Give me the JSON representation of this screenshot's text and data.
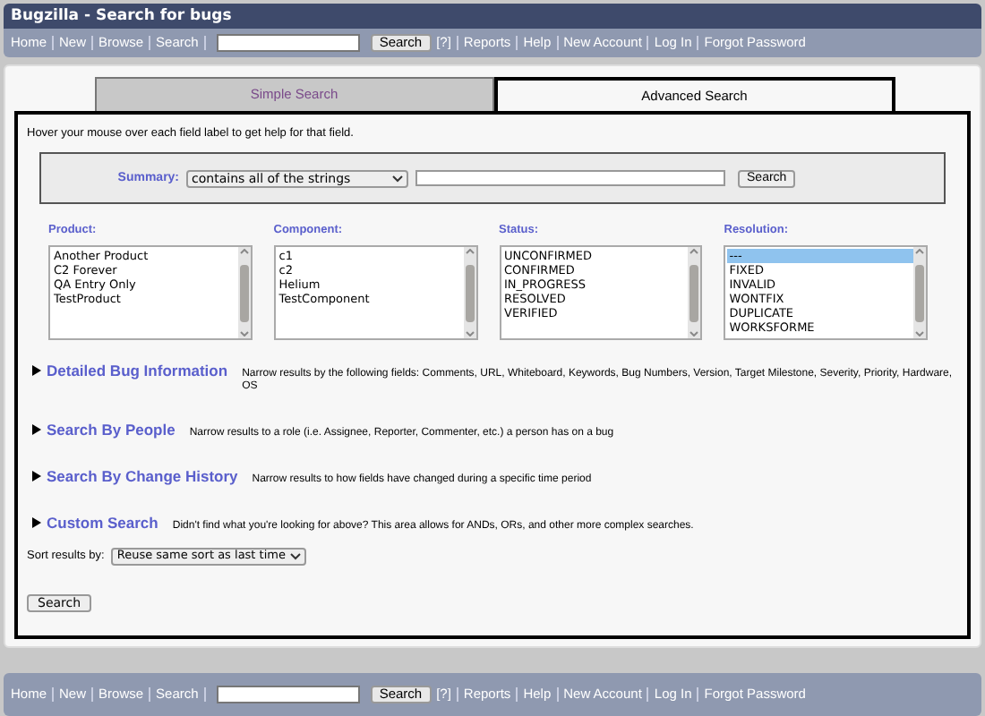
{
  "window": {
    "title": "Bugzilla - Search for bugs"
  },
  "top_nav": {
    "links_before": [
      "Home",
      "New",
      "Browse",
      "Search"
    ],
    "button": "Search",
    "help": "[?]",
    "links_after": [
      "Reports",
      "Help",
      "New Account",
      "Log In",
      "Forgot Password"
    ]
  },
  "tabs": [
    {
      "label": "Simple Search",
      "selected": false
    },
    {
      "label": "Advanced Search",
      "selected": true
    }
  ],
  "hint": "Hover your mouse over each field label to get help for that field.",
  "summary": {
    "label": "Summary:",
    "operator": "contains all of the strings",
    "button": "Search"
  },
  "lists": [
    {
      "label": "Product:",
      "items": [
        {
          "text": "Another Product",
          "selected": false
        },
        {
          "text": "C2 Forever",
          "selected": false
        },
        {
          "text": "QA Entry Only",
          "selected": false
        },
        {
          "text": "TestProduct",
          "selected": false
        }
      ]
    },
    {
      "label": "Component:",
      "items": [
        {
          "text": "c1",
          "selected": false
        },
        {
          "text": "c2",
          "selected": false
        },
        {
          "text": "Helium",
          "selected": false
        },
        {
          "text": "TestComponent",
          "selected": false
        }
      ]
    },
    {
      "label": "Status:",
      "items": [
        {
          "text": "UNCONFIRMED",
          "selected": false
        },
        {
          "text": "CONFIRMED",
          "selected": false
        },
        {
          "text": "IN_PROGRESS",
          "selected": false
        },
        {
          "text": "RESOLVED",
          "selected": false
        },
        {
          "text": "VERIFIED",
          "selected": false
        }
      ]
    },
    {
      "label": "Resolution:",
      "items": [
        {
          "text": "---",
          "selected": true
        },
        {
          "text": "FIXED",
          "selected": false
        },
        {
          "text": "INVALID",
          "selected": false
        },
        {
          "text": "WONTFIX",
          "selected": false
        },
        {
          "text": "DUPLICATE",
          "selected": false
        },
        {
          "text": "WORKSFORME",
          "selected": false
        }
      ]
    }
  ],
  "sections": [
    {
      "title": "Detailed Bug Information",
      "description": "Narrow results by the following fields: Comments, URL, Whiteboard, Keywords, Bug Numbers, Version, Target Milestone, Severity, Priority, Hardware, OS",
      "expanded": false
    },
    {
      "title": "Search By People",
      "description": "Narrow results to a role (i.e. Assignee, Reporter, Commenter, etc.) a person has on a bug",
      "expanded": false
    },
    {
      "title": "Search By Change History",
      "description": "Narrow results to how fields have changed during a specific time period",
      "expanded": false
    },
    {
      "title": "Custom Search",
      "description": "Didn't find what you're looking for above? This area allows for ANDs, ORs, and other more complex searches.",
      "expanded": false
    }
  ],
  "sort": {
    "label": "Sort results by:",
    "value": "Reuse same sort as last time"
  },
  "search_button": "Search",
  "bottom_nav": {
    "links_before": [
      "Home",
      "New",
      "Browse",
      "Search"
    ],
    "button": "Search",
    "help": "[?]",
    "links_after": [
      "Reports",
      "Help",
      "New Account",
      "Log In",
      "Forgot Password"
    ]
  }
}
